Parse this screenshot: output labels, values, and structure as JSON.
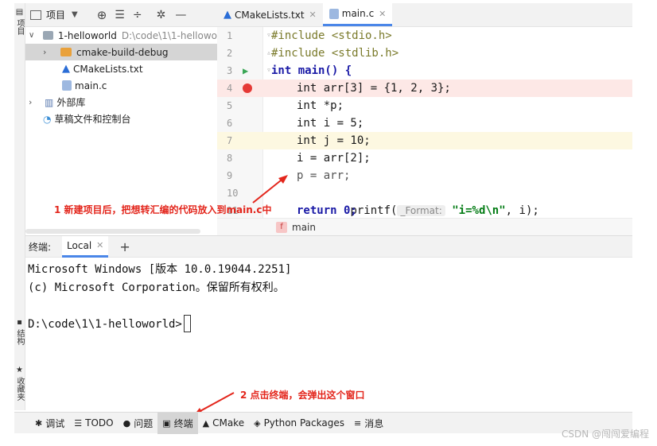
{
  "left_strip": {
    "top_label": "项目",
    "mid_label": "结构",
    "bottom_label": "收藏夹"
  },
  "project_panel": {
    "title": "项目",
    "tree": [
      {
        "label": "1-helloworld",
        "path": "D:\\code\\1\\1-hellowo",
        "expanded": true
      },
      {
        "label": "cmake-build-debug",
        "selected": true
      },
      {
        "label": "CMakeLists.txt"
      },
      {
        "label": "main.c"
      },
      {
        "label": "外部库"
      },
      {
        "label": "草稿文件和控制台"
      }
    ]
  },
  "editor": {
    "tabs": [
      {
        "label": "CMakeLists.txt",
        "active": false
      },
      {
        "label": "main.c",
        "active": true
      }
    ],
    "line_numbers": [
      "1",
      "2",
      "3",
      "4",
      "5",
      "6",
      "7",
      "8",
      "9",
      "10",
      "11"
    ],
    "lines": {
      "l1": "#include <stdio.h>",
      "l2": "#include <stdlib.h>",
      "l3": "int main() {",
      "l4": "int arr[3] = {1, 2, 3};",
      "l5": "int *p;",
      "l6": "int i = 5;",
      "l7": "int j = 10;",
      "l8": "i = arr[2];",
      "l9": "p = arr;",
      "l10_pre": "printf(",
      "l10_hint": "_Format:",
      "l10_str": "\"i=%d\\n\"",
      "l10_post": ", i);",
      "l11": "return 0;"
    },
    "breadcrumb": "main",
    "breadcrumb_badge": "f"
  },
  "annotations": {
    "editor_note": "1 新建项目后，把想转汇编的代码放入到main.c中",
    "terminal_note": "2 点击终端，会弹出这个窗口"
  },
  "terminal": {
    "header_label": "终端:",
    "tab_label": "Local",
    "lines": [
      "Microsoft Windows [版本 10.0.19044.2251]",
      "(c) Microsoft Corporation。保留所有权利。",
      "D:\\code\\1\\1-helloworld>"
    ]
  },
  "bottom_bar": {
    "items": [
      {
        "label": "调试",
        "icon": "bug-icon"
      },
      {
        "label": "TODO",
        "icon": "list-icon"
      },
      {
        "label": "问题",
        "icon": "info-icon"
      },
      {
        "label": "终端",
        "icon": "terminal-icon",
        "active": true
      },
      {
        "label": "CMake",
        "icon": "cmake-icon"
      },
      {
        "label": "Python Packages",
        "icon": "layers-icon"
      },
      {
        "label": "消息",
        "icon": "messages-icon"
      }
    ]
  },
  "watermark": "CSDN @闯闯爱编程",
  "colors": {
    "accent": "#4a86e8",
    "annotation": "#e3261c",
    "breakpoint": "#e53935",
    "breakpoint_line": "#fde8e6",
    "caret_line": "#fdf8e1"
  }
}
